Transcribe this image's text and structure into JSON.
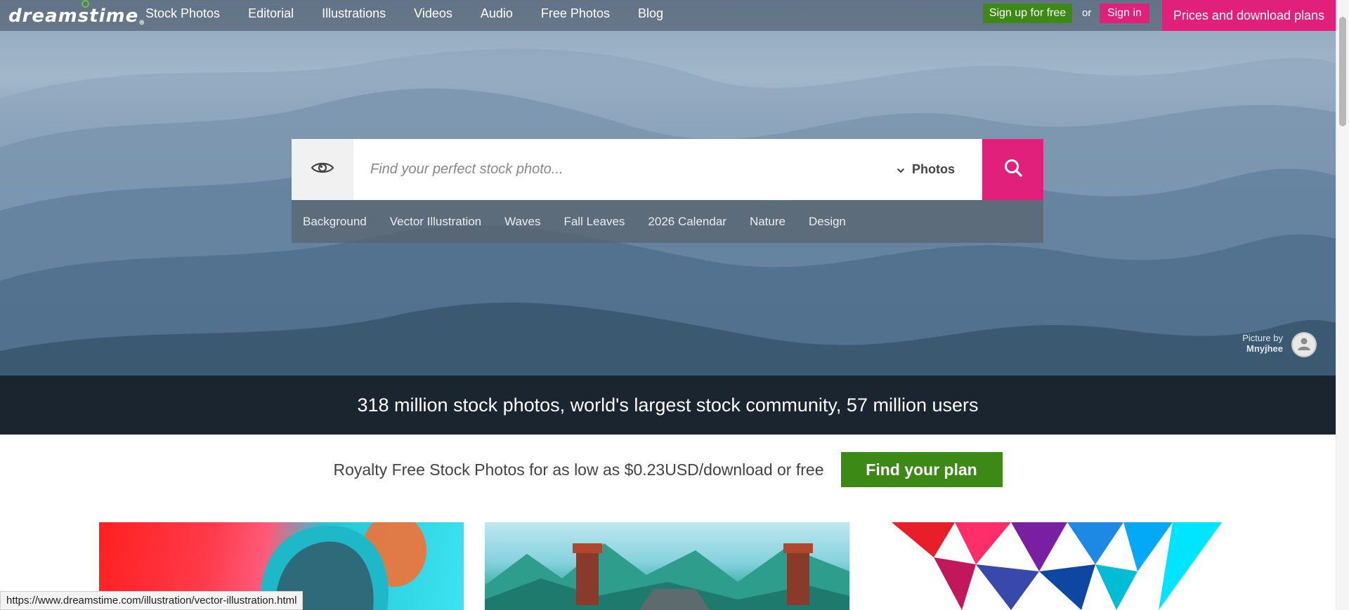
{
  "header": {
    "logo_text": "dreamstime",
    "nav": [
      "Stock Photos",
      "Editorial",
      "Illustrations",
      "Videos",
      "Audio",
      "Free Photos",
      "Blog"
    ],
    "signup_label": "Sign up for free",
    "or_text": "or",
    "signin_label": "Sign in",
    "prices_label": "Prices and download plans"
  },
  "search": {
    "placeholder": "Find your perfect stock photo...",
    "type_value": "Photos",
    "suggestions": [
      "Background",
      "Vector Illustration",
      "Waves",
      "Fall Leaves",
      "2026 Calendar",
      "Nature",
      "Design"
    ]
  },
  "credit": {
    "line1": "Picture by",
    "author": "Mnyjhee"
  },
  "stats_text": "318 million stock photos, world's largest stock community, 57 million users",
  "promo": {
    "text": "Royalty Free Stock Photos for as low as $0.23USD/download or free",
    "button_label": "Find your plan"
  },
  "status_url": "https://www.dreamstime.com/illustration/vector-illustration.html",
  "colors": {
    "brand_pink": "#e0207b",
    "brand_green": "#3c8a15"
  },
  "icons": [
    "eye-icon",
    "chevron-down-icon",
    "search-icon",
    "user-avatar-icon"
  ]
}
